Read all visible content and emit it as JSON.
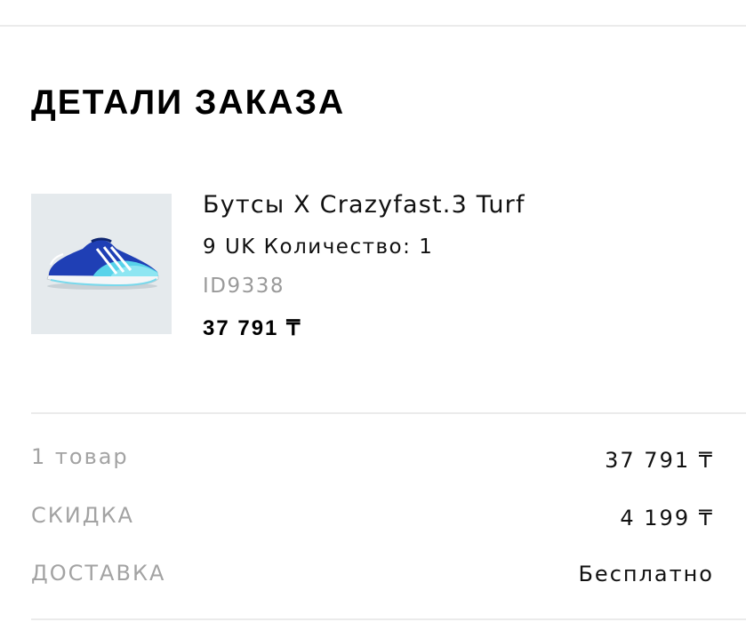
{
  "order": {
    "title": "ДЕТАЛИ ЗАКАЗА",
    "item": {
      "image_alt": "shoe-image",
      "name": "Бутсы X Crazyfast.3 Turf",
      "size_qty": "9 UK Количество: 1",
      "sku": "ID9338",
      "price": "37 791 ₸"
    },
    "summary": {
      "items_label": "1 товар",
      "items_value": "37 791 ₸",
      "discount_label": "СКИДКА",
      "discount_value": "4 199 ₸",
      "delivery_label": "ДОСТАВКА",
      "delivery_value": "Бесплатно"
    }
  },
  "colors": {
    "background": "#ffffff",
    "text": "#111111",
    "muted": "#a3a3a3",
    "divider": "#ebebeb",
    "thumb_bg": "#e5eaed",
    "shoe_blue": "#1f3fb5",
    "shoe_aqua": "#58d3ea"
  }
}
